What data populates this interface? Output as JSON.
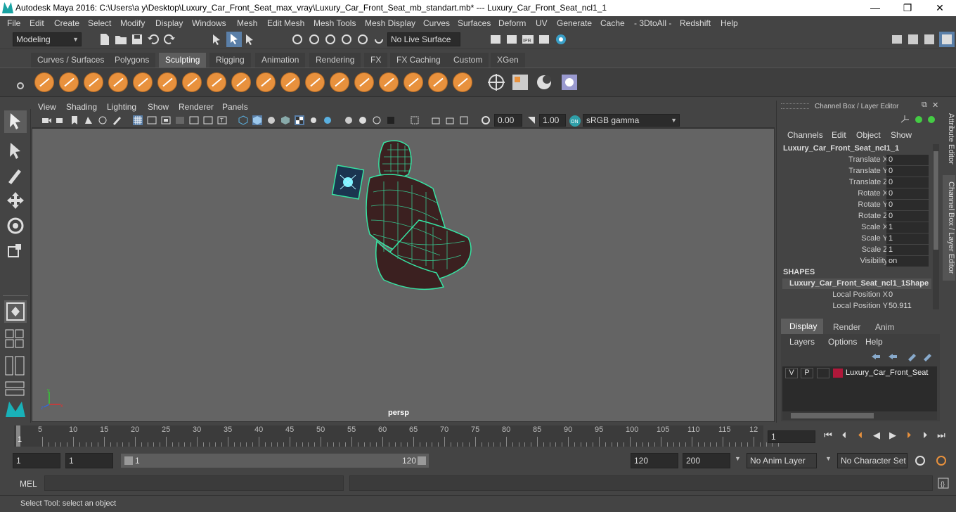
{
  "window": {
    "title": "Autodesk Maya 2016: C:\\Users\\a y\\Desktop\\Luxury_Car_Front_Seat_max_vray\\Luxury_Car_Front_Seat_mb_standart.mb*   ---   Luxury_Car_Front_Seat_ncl1_1",
    "minimize": "—",
    "maximize": "❐",
    "close": "✕"
  },
  "menubar": [
    "File",
    "Edit",
    "Create",
    "Select",
    "Modify",
    "Display",
    "Windows",
    "Mesh",
    "Edit Mesh",
    "Mesh Tools",
    "Mesh Display",
    "Curves",
    "Surfaces",
    "Deform",
    "UV",
    "Generate",
    "Cache",
    "- 3DtoAll -",
    "Redshift",
    "Help"
  ],
  "statusline": {
    "mode": "Modeling",
    "live_surface": "No Live Surface"
  },
  "shelf_tabs": [
    "Curves / Surfaces",
    "Polygons",
    "Sculpting",
    "Rigging",
    "Animation",
    "Rendering",
    "FX",
    "FX Caching",
    "Custom",
    "XGen"
  ],
  "shelf_active": "Sculpting",
  "shelf_tools": [
    "sculpt-icon",
    "smooth-icon",
    "relax-icon",
    "grab-icon",
    "pinch-icon",
    "flatten-icon",
    "foamy-icon",
    "spray-icon",
    "repeat-icon",
    "imprint-icon",
    "wax-icon",
    "scrape-icon",
    "fill-icon",
    "knife-icon",
    "smear-icon",
    "bulge-icon",
    "amplify-icon",
    "freeze-icon"
  ],
  "viewport": {
    "menu": [
      "View",
      "Shading",
      "Lighting",
      "Show",
      "Renderer",
      "Panels"
    ],
    "exposure": "0.00",
    "gamma": "1.00",
    "colorspace": "sRGB gamma",
    "camera_label": "persp"
  },
  "channel_box": {
    "header": "Channel Box / Layer Editor",
    "menu": [
      "Channels",
      "Edit",
      "Object",
      "Show"
    ],
    "object_name": "Luxury_Car_Front_Seat_ncl1_1",
    "attributes": [
      {
        "label": "Translate X",
        "value": "0"
      },
      {
        "label": "Translate Y",
        "value": "0"
      },
      {
        "label": "Translate Z",
        "value": "0"
      },
      {
        "label": "Rotate X",
        "value": "0"
      },
      {
        "label": "Rotate Y",
        "value": "0"
      },
      {
        "label": "Rotate Z",
        "value": "0"
      },
      {
        "label": "Scale X",
        "value": "1"
      },
      {
        "label": "Scale Y",
        "value": "1"
      },
      {
        "label": "Scale Z",
        "value": "1"
      },
      {
        "label": "Visibility",
        "value": "on"
      }
    ],
    "shapes_header": "SHAPES",
    "shape_name": "Luxury_Car_Front_Seat_ncl1_1Shape",
    "shape_attributes": [
      {
        "label": "Local Position X",
        "value": "0"
      },
      {
        "label": "Local Position Y",
        "value": "50.911"
      }
    ]
  },
  "layer_editor": {
    "tabs": [
      "Display",
      "Render",
      "Anim"
    ],
    "active_tab": "Display",
    "menu": [
      "Layers",
      "Options",
      "Help"
    ],
    "layer": {
      "v": "V",
      "p": "P",
      "name": "Luxury_Car_Front_Seat",
      "color": "#b0183a"
    }
  },
  "side_tabs": [
    "Attribute Editor",
    "Channel Box / Layer Editor"
  ],
  "timeline": {
    "ticks": [
      "5",
      "10",
      "15",
      "20",
      "25",
      "30",
      "35",
      "40",
      "45",
      "50",
      "55",
      "60",
      "65",
      "70",
      "75",
      "80",
      "85",
      "90",
      "95",
      "100",
      "105",
      "110",
      "115",
      "12"
    ],
    "start_marker": "1",
    "current_frame": "1"
  },
  "range": {
    "start": "1",
    "playback_start": "1",
    "slider_start": "1",
    "slider_end": "120",
    "playback_end": "120",
    "end": "200",
    "anim_layer": "No Anim Layer",
    "character_set": "No Character Set"
  },
  "mel": {
    "label": "MEL"
  },
  "help_line": "Select Tool: select an object"
}
